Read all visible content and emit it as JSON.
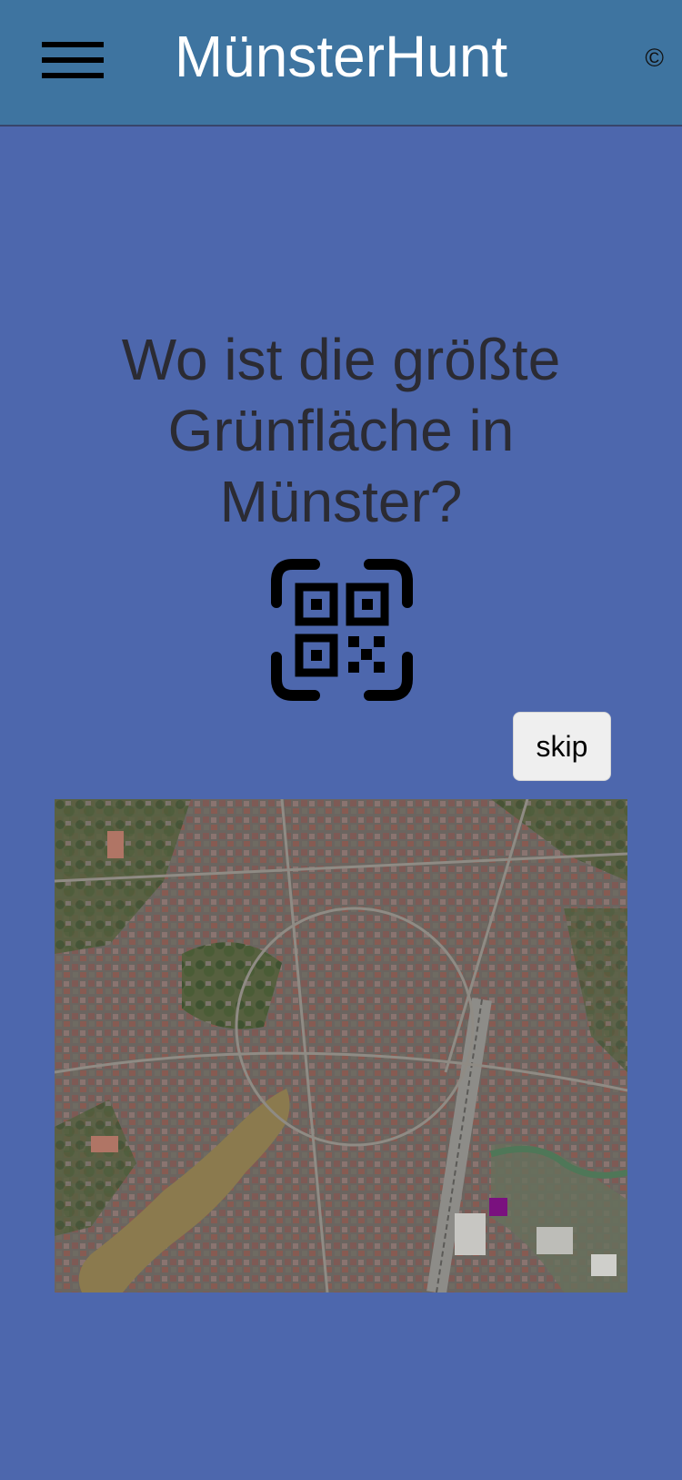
{
  "app": {
    "title": "MünsterHunt",
    "copyright_symbol": "©",
    "menu_icon": "hamburger-menu-icon"
  },
  "quiz": {
    "question": "Wo ist die größte Grünfläche in Münster?",
    "scan_icon": "qr-code-icon",
    "skip_label": "skip"
  },
  "map": {
    "type": "satellite",
    "marker_color": "#7a117f"
  },
  "colors": {
    "header": "#3e74a0",
    "background": "#4d67ad",
    "question_text": "#2b2b33",
    "title_text": "#ffffff"
  }
}
